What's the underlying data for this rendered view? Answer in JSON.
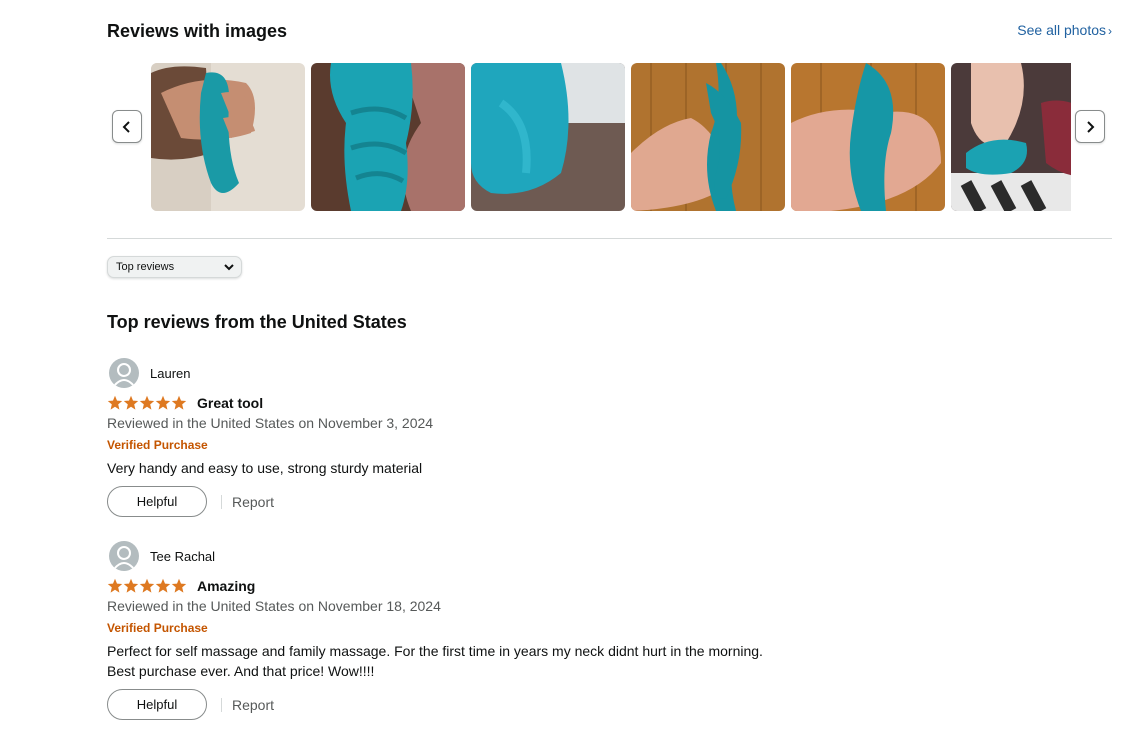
{
  "images_section": {
    "title": "Reviews with images",
    "see_all_label": "See all photos",
    "prev_icon": "chevron-left-icon",
    "next_icon": "chevron-right-icon",
    "thumbnails_count_visible": 6
  },
  "sort": {
    "selected": "Top reviews",
    "icon": "chevron-down-icon"
  },
  "reviews_heading": "Top reviews from the United States",
  "reviews": [
    {
      "author": "Lauren",
      "rating": 5,
      "title": "Great tool",
      "date_line": "Reviewed in the United States on November 3, 2024",
      "verified": "Verified Purchase",
      "body_lines": [
        "Very handy and easy to use, strong sturdy material"
      ],
      "helpful_label": "Helpful",
      "report_label": "Report"
    },
    {
      "author": "Tee Rachal",
      "rating": 5,
      "title": "Amazing",
      "date_line": "Reviewed in the United States on November 18, 2024",
      "verified": "Verified Purchase",
      "body_lines": [
        "Perfect for self massage and family massage. For the first time in years my neck didnt hurt in the morning.",
        "Best purchase ever. And that price! Wow!!!!"
      ],
      "helpful_label": "Helpful",
      "report_label": "Report"
    }
  ],
  "colors": {
    "star": "#de7921",
    "verified": "#c45500",
    "link": "#2162a1",
    "product_teal": "#1a9aa6"
  }
}
